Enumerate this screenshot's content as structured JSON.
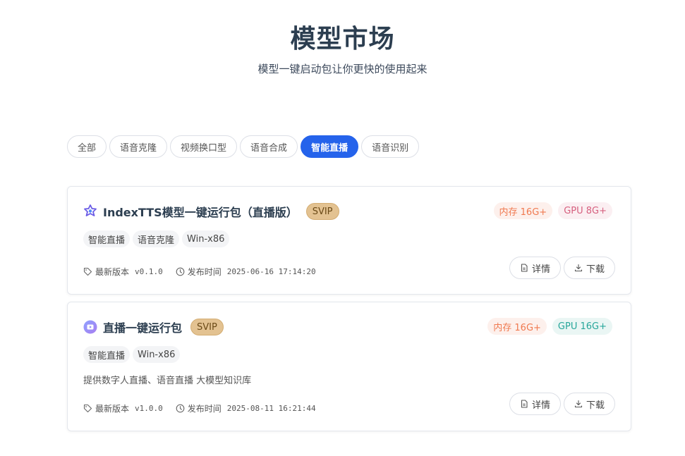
{
  "header": {
    "title": "模型市场",
    "subtitle": "模型一键启动包让你更快的使用起来"
  },
  "tabs": [
    {
      "label": "全部",
      "active": false
    },
    {
      "label": "语音克隆",
      "active": false
    },
    {
      "label": "视频换口型",
      "active": false
    },
    {
      "label": "语音合成",
      "active": false
    },
    {
      "label": "智能直播",
      "active": true
    },
    {
      "label": "语音识别",
      "active": false
    }
  ],
  "labels": {
    "latest_version": "最新版本",
    "release_time": "发布时间",
    "details_button": "详情",
    "download_button": "下载"
  },
  "cards": [
    {
      "name": "IndexTTS模型一键运行包（直播版）",
      "icon": "indextts-logo-icon",
      "badge": "SVIP",
      "memory": "内存 16G+",
      "gpu": "GPU 8G+",
      "tags": [
        "智能直播",
        "语音克隆",
        "Win-x86"
      ],
      "description": "",
      "version": "v0.1.0",
      "release_time": "2025-06-16 17:14:20"
    },
    {
      "name": "直播一键运行包",
      "icon": "live-play-icon",
      "badge": "SVIP",
      "memory": "内存 16G+",
      "gpu": "GPU 16G+",
      "tags": [
        "智能直播",
        "Win-x86"
      ],
      "description": "提供数字人直播、语音直播 大模型知识库",
      "version": "v1.0.0",
      "release_time": "2025-08-11 16:21:44"
    }
  ],
  "colors": {
    "accent": "#2563eb",
    "svip": "#e3c291",
    "memory": "#f0794f",
    "gpu_pink": "#d6607f",
    "gpu_teal": "#26a69a"
  }
}
